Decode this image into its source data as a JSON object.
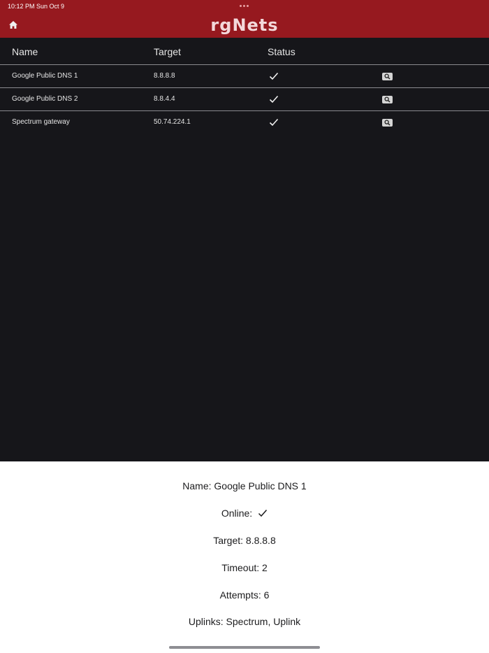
{
  "status_bar": {
    "time_date": "10:12 PM   Sun Oct 9"
  },
  "header": {
    "logo_text": "rgNets"
  },
  "table": {
    "columns": {
      "name": "Name",
      "target": "Target",
      "status": "Status"
    },
    "rows": [
      {
        "name": "Google Public DNS 1",
        "target": "8.8.8.8",
        "status": "online"
      },
      {
        "name": "Google Public DNS 2",
        "target": "8.8.4.4",
        "status": "online"
      },
      {
        "name": "Spectrum gateway",
        "target": "50.74.224.1",
        "status": "online"
      }
    ]
  },
  "detail": {
    "name": "Name: Google Public DNS 1",
    "online_label": "Online:",
    "target": "Target: 8.8.8.8",
    "timeout": "Timeout: 2",
    "attempts": "Attempts: 6",
    "uplinks": "Uplinks: Spectrum, Uplink"
  },
  "colors": {
    "brand_red": "#96191f",
    "background_dark": "#16161a",
    "detail_bg": "#ffffff"
  },
  "icons": {
    "home": "home-icon",
    "status": "checkmark-icon",
    "details": "magnifier-icon"
  }
}
